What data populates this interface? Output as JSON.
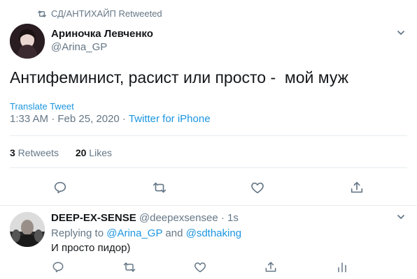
{
  "retweet_banner": {
    "text": "СД/АНТИХАЙП Retweeted",
    "icon": "retweet-icon"
  },
  "tweet": {
    "display_name": "Ариночка Левченко",
    "handle": "@Arina_GP",
    "text": "Антифеминист, расист или просто -  мой муж",
    "translate_label": "Translate Tweet",
    "timestamp": "1:33 AM · Feb 25, 2020 · ",
    "source": "Twitter for iPhone",
    "retweets_count": "3",
    "retweets_label": " Retweets",
    "likes_count": "20",
    "likes_label": " Likes"
  },
  "reply": {
    "display_name": "DEEP-EX-SENSE",
    "handle": " @deepexsensee · 1s",
    "replying_prefix": "Replying to ",
    "mention1": "@Arina_GP",
    "and_text": " and ",
    "mention2": "@sdthaking",
    "text": "И просто пидор)"
  },
  "colors": {
    "accent": "#1b95e0",
    "muted": "#657786",
    "text": "#14171a",
    "divider": "#e6ecf0"
  }
}
